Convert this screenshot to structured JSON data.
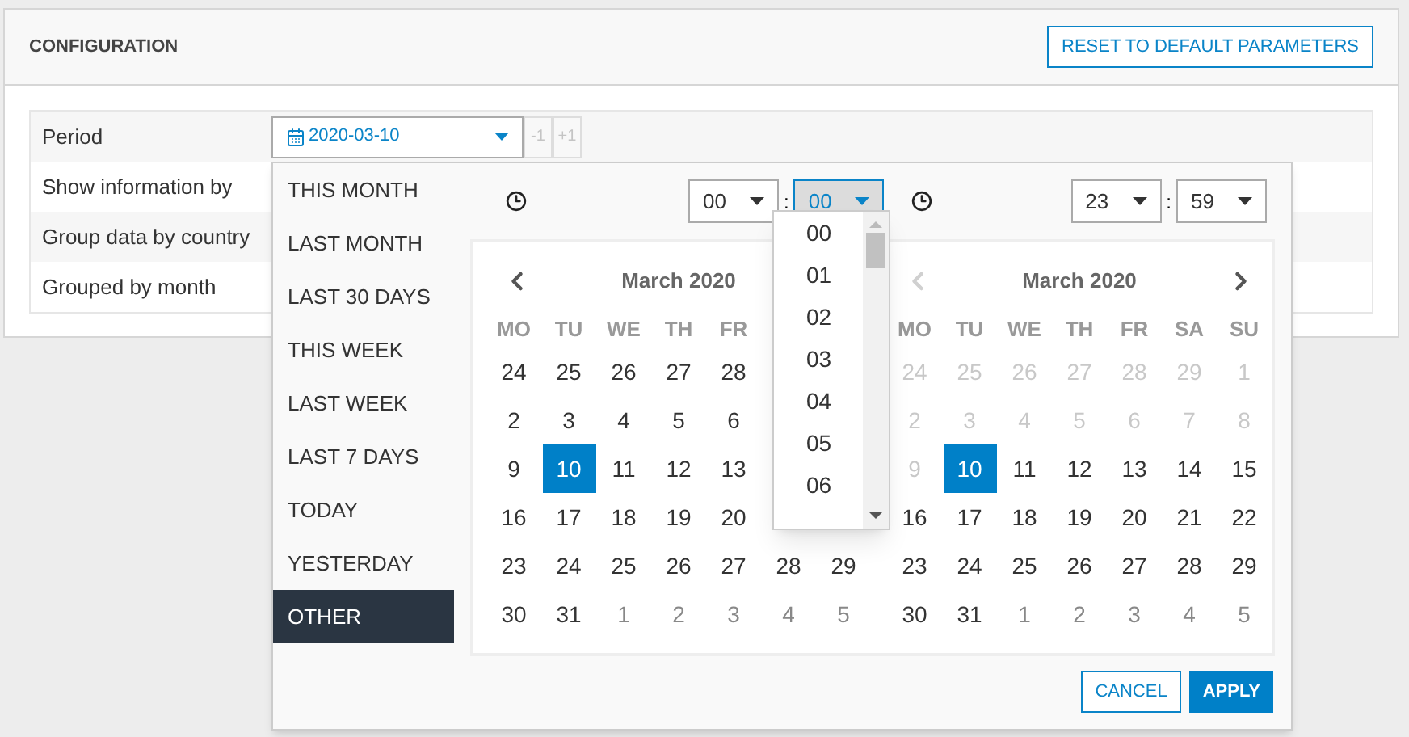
{
  "header": {
    "title": "CONFIGURATION",
    "reset_button": "RESET TO DEFAULT PARAMETERS"
  },
  "settings": [
    {
      "label": "Period"
    },
    {
      "label": "Show information by"
    },
    {
      "label": "Group data by country"
    },
    {
      "label": "Grouped by month"
    }
  ],
  "period": {
    "value": "2020-03-10",
    "steps": [
      {
        "label": "-1",
        "disabled": true
      },
      {
        "label": "+1",
        "disabled": true
      }
    ]
  },
  "presets": [
    {
      "label": "THIS MONTH",
      "selected": false
    },
    {
      "label": "LAST MONTH",
      "selected": false
    },
    {
      "label": "LAST 30 DAYS",
      "selected": false
    },
    {
      "label": "THIS WEEK",
      "selected": false
    },
    {
      "label": "LAST WEEK",
      "selected": false
    },
    {
      "label": "LAST 7 DAYS",
      "selected": false
    },
    {
      "label": "TODAY",
      "selected": false
    },
    {
      "label": "YESTERDAY",
      "selected": false
    },
    {
      "label": "OTHER",
      "selected": true
    }
  ],
  "time_from": {
    "hour": {
      "value": "00",
      "focused": false
    },
    "separator": ":",
    "minute": {
      "value": "00",
      "focused": true,
      "options": [
        "00",
        "01",
        "02",
        "03",
        "04",
        "05",
        "06"
      ]
    }
  },
  "time_to": {
    "hour": {
      "value": "23",
      "focused": false
    },
    "separator": ":",
    "minute": {
      "value": "59",
      "focused": false
    }
  },
  "calendars": [
    {
      "title": "March 2020",
      "prev_disabled": false,
      "weekdays": [
        "MO",
        "TU",
        "WE",
        "TH",
        "FR"
      ],
      "weeks": [
        [
          {
            "text": "24",
            "kind": "day",
            "selected": false
          },
          {
            "text": "25",
            "kind": "day",
            "selected": false
          },
          {
            "text": "26",
            "kind": "day",
            "selected": false
          },
          {
            "text": "27",
            "kind": "day",
            "selected": false
          },
          {
            "text": "28",
            "kind": "day",
            "selected": false
          }
        ],
        [
          {
            "text": "2",
            "kind": "day",
            "selected": false
          },
          {
            "text": "3",
            "kind": "day",
            "selected": false
          },
          {
            "text": "4",
            "kind": "day",
            "selected": false
          },
          {
            "text": "5",
            "kind": "day",
            "selected": false
          },
          {
            "text": "6",
            "kind": "day",
            "selected": false
          }
        ],
        [
          {
            "text": "9",
            "kind": "day",
            "selected": false
          },
          {
            "text": "10",
            "kind": "day",
            "selected": true
          },
          {
            "text": "11",
            "kind": "day",
            "selected": false
          },
          {
            "text": "12",
            "kind": "day",
            "selected": false
          },
          {
            "text": "13",
            "kind": "day",
            "selected": false
          }
        ],
        [
          {
            "text": "16",
            "kind": "day",
            "selected": false
          },
          {
            "text": "17",
            "kind": "day",
            "selected": false
          },
          {
            "text": "18",
            "kind": "day",
            "selected": false
          },
          {
            "text": "19",
            "kind": "day",
            "selected": false
          },
          {
            "text": "20",
            "kind": "day",
            "selected": false
          }
        ],
        [
          {
            "text": "23",
            "kind": "day",
            "selected": false
          },
          {
            "text": "24",
            "kind": "day",
            "selected": false
          },
          {
            "text": "25",
            "kind": "day",
            "selected": false
          },
          {
            "text": "26",
            "kind": "day",
            "selected": false
          },
          {
            "text": "27",
            "kind": "day",
            "selected": false
          },
          {
            "text": "28",
            "kind": "day",
            "selected": false
          },
          {
            "text": "29",
            "kind": "day",
            "selected": false
          }
        ],
        [
          {
            "text": "30",
            "kind": "day",
            "selected": false
          },
          {
            "text": "31",
            "kind": "day",
            "selected": false
          },
          {
            "text": "1",
            "kind": "adjacent",
            "selected": false
          },
          {
            "text": "2",
            "kind": "adjacent",
            "selected": false
          },
          {
            "text": "3",
            "kind": "adjacent",
            "selected": false
          },
          {
            "text": "4",
            "kind": "adjacent",
            "selected": false
          },
          {
            "text": "5",
            "kind": "adjacent",
            "selected": false
          }
        ]
      ]
    },
    {
      "title": "March 2020",
      "prev_disabled": true,
      "show_next": true,
      "weekdays": [
        "MO",
        "TU",
        "WE",
        "TH",
        "FR",
        "SA",
        "SU"
      ],
      "weeks": [
        [
          {
            "text": "24",
            "kind": "disabled",
            "selected": false
          },
          {
            "text": "25",
            "kind": "disabled",
            "selected": false
          },
          {
            "text": "26",
            "kind": "disabled",
            "selected": false
          },
          {
            "text": "27",
            "kind": "disabled",
            "selected": false
          },
          {
            "text": "28",
            "kind": "disabled",
            "selected": false
          },
          {
            "text": "29",
            "kind": "disabled",
            "selected": false
          },
          {
            "text": "1",
            "kind": "disabled",
            "selected": false
          }
        ],
        [
          {
            "text": "2",
            "kind": "disabled",
            "selected": false
          },
          {
            "text": "3",
            "kind": "disabled",
            "selected": false
          },
          {
            "text": "4",
            "kind": "disabled",
            "selected": false
          },
          {
            "text": "5",
            "kind": "disabled",
            "selected": false
          },
          {
            "text": "6",
            "kind": "disabled",
            "selected": false
          },
          {
            "text": "7",
            "kind": "disabled",
            "selected": false
          },
          {
            "text": "8",
            "kind": "disabled",
            "selected": false
          }
        ],
        [
          {
            "text": "9",
            "kind": "disabled",
            "selected": false
          },
          {
            "text": "10",
            "kind": "day",
            "selected": true
          },
          {
            "text": "11",
            "kind": "day",
            "selected": false
          },
          {
            "text": "12",
            "kind": "day",
            "selected": false
          },
          {
            "text": "13",
            "kind": "day",
            "selected": false
          },
          {
            "text": "14",
            "kind": "day",
            "selected": false
          },
          {
            "text": "15",
            "kind": "day",
            "selected": false
          }
        ],
        [
          {
            "text": "16",
            "kind": "day",
            "selected": false
          },
          {
            "text": "17",
            "kind": "day",
            "selected": false
          },
          {
            "text": "18",
            "kind": "day",
            "selected": false
          },
          {
            "text": "19",
            "kind": "day",
            "selected": false
          },
          {
            "text": "20",
            "kind": "day",
            "selected": false
          },
          {
            "text": "21",
            "kind": "day",
            "selected": false
          },
          {
            "text": "22",
            "kind": "day",
            "selected": false
          }
        ],
        [
          {
            "text": "23",
            "kind": "day",
            "selected": false
          },
          {
            "text": "24",
            "kind": "day",
            "selected": false
          },
          {
            "text": "25",
            "kind": "day",
            "selected": false
          },
          {
            "text": "26",
            "kind": "day",
            "selected": false
          },
          {
            "text": "27",
            "kind": "day",
            "selected": false
          },
          {
            "text": "28",
            "kind": "day",
            "selected": false
          },
          {
            "text": "29",
            "kind": "day",
            "selected": false
          }
        ],
        [
          {
            "text": "30",
            "kind": "day",
            "selected": false
          },
          {
            "text": "31",
            "kind": "day",
            "selected": false
          },
          {
            "text": "1",
            "kind": "adjacent",
            "selected": false
          },
          {
            "text": "2",
            "kind": "adjacent",
            "selected": false
          },
          {
            "text": "3",
            "kind": "adjacent",
            "selected": false
          },
          {
            "text": "4",
            "kind": "adjacent",
            "selected": false
          },
          {
            "text": "5",
            "kind": "adjacent",
            "selected": false
          }
        ]
      ]
    }
  ],
  "actions": {
    "cancel": "CANCEL",
    "apply": "APPLY"
  }
}
